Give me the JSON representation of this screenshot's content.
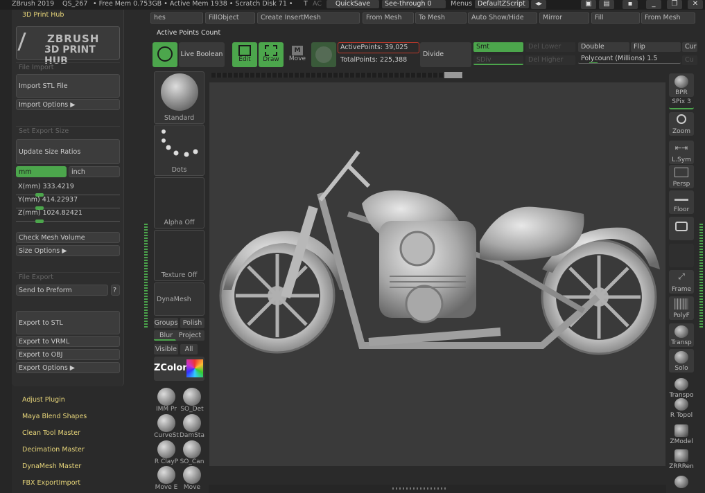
{
  "titlebar": {
    "app": "ZBrush 2019",
    "doc": "QS_267",
    "stats": "• Free Mem 0.753GB • Active Mem 1938 • Scratch Disk 71 •",
    "t_label": "T",
    "ac_label": "AC",
    "quicksave": "QuickSave",
    "see_through_label": "See-through",
    "see_through_value": "0",
    "menus": "Menus",
    "script": "DefaultZScript"
  },
  "plugin_hub": {
    "title": "3D Print Hub",
    "logo_top": "ZBRUSH",
    "logo_bottom": "3D PRINT HUB",
    "file_import": "File Import",
    "import_stl": "Import STL File",
    "import_options": "Import Options ▶",
    "set_export_size": "Set Export Size",
    "update_size_ratios": "Update Size Ratios",
    "unit_mm": "mm",
    "unit_inch": "inch",
    "x_label": "X(mm)",
    "x_value": "333.4219",
    "y_label": "Y(mm)",
    "y_value": "414.22937",
    "z_label": "Z(mm)",
    "z_value": "1024.82421",
    "check_mesh_volume": "Check Mesh Volume",
    "size_options": "Size Options ▶",
    "file_export": "File Export",
    "send_to_preform": "Send to Preform",
    "help": "?",
    "export_stl": "Export to STL",
    "export_vrml": "Export to VRML",
    "export_obj": "Export to OBJ",
    "export_options": "Export Options ▶"
  },
  "plugins": [
    "Adjust Plugin",
    "Maya Blend Shapes",
    "Clean Tool Master",
    "Decimation Master",
    "DynaMesh Master",
    "FBX ExportImport"
  ],
  "shelf": {
    "row1": [
      "hes",
      "FillObject",
      "Create InsertMesh",
      "From Mesh",
      "To Mesh",
      "Auto Show/Hide",
      "Mirror",
      "Fill",
      "From Mesh"
    ],
    "active_points_count": "Active Points Count"
  },
  "toolbar": {
    "live_boolean": "Live Boolean",
    "edit": "Edit",
    "draw": "Draw",
    "move": "Move",
    "move_letter": "M",
    "active_points": "ActivePoints: 39,025",
    "total_points": "TotalPoints: 225,388",
    "divide": "Divide",
    "smt": "Smt",
    "sdiv": "SDiv",
    "del_lower": "Del Lower",
    "del_higher": "Del Higher",
    "double": "Double",
    "flip": "Flip",
    "cur": "Cur",
    "cu2": "Cu",
    "polycount": "Polycount (Millions) 1.5"
  },
  "brushes": {
    "standard": "Standard",
    "dots": "Dots",
    "alpha_off": "Alpha Off",
    "texture_off": "Texture Off",
    "dynamesh": "DynaMesh",
    "groups": "Groups",
    "polish": "Polish",
    "blur": "Blur",
    "project": "Project",
    "visible": "Visible",
    "all": "All",
    "zcolor": "ZColor",
    "minis": [
      "IMM Pr",
      "SO_Det",
      "CurveSt",
      "DamSta",
      "R ClayP",
      "SO_Can",
      "Move E",
      "Move"
    ]
  },
  "right_tools": {
    "bpr": "BPR",
    "spix": "SPix",
    "spix_value": "3",
    "zoom": "Zoom",
    "lsym": "L.Sym",
    "persp": "Persp",
    "floor": "Floor",
    "frame": "Frame",
    "polyf": "PolyF",
    "transp": "Transp",
    "solo": "Solo",
    "transpose": "Transpo",
    "rtopol": "R Topol",
    "zmodel": "ZModel",
    "zrrren": "ZRRRen"
  },
  "colors": {
    "accent_green": "#4ca64c",
    "plugin_text": "#e8d67a",
    "active_points_border": "#c0392b"
  }
}
